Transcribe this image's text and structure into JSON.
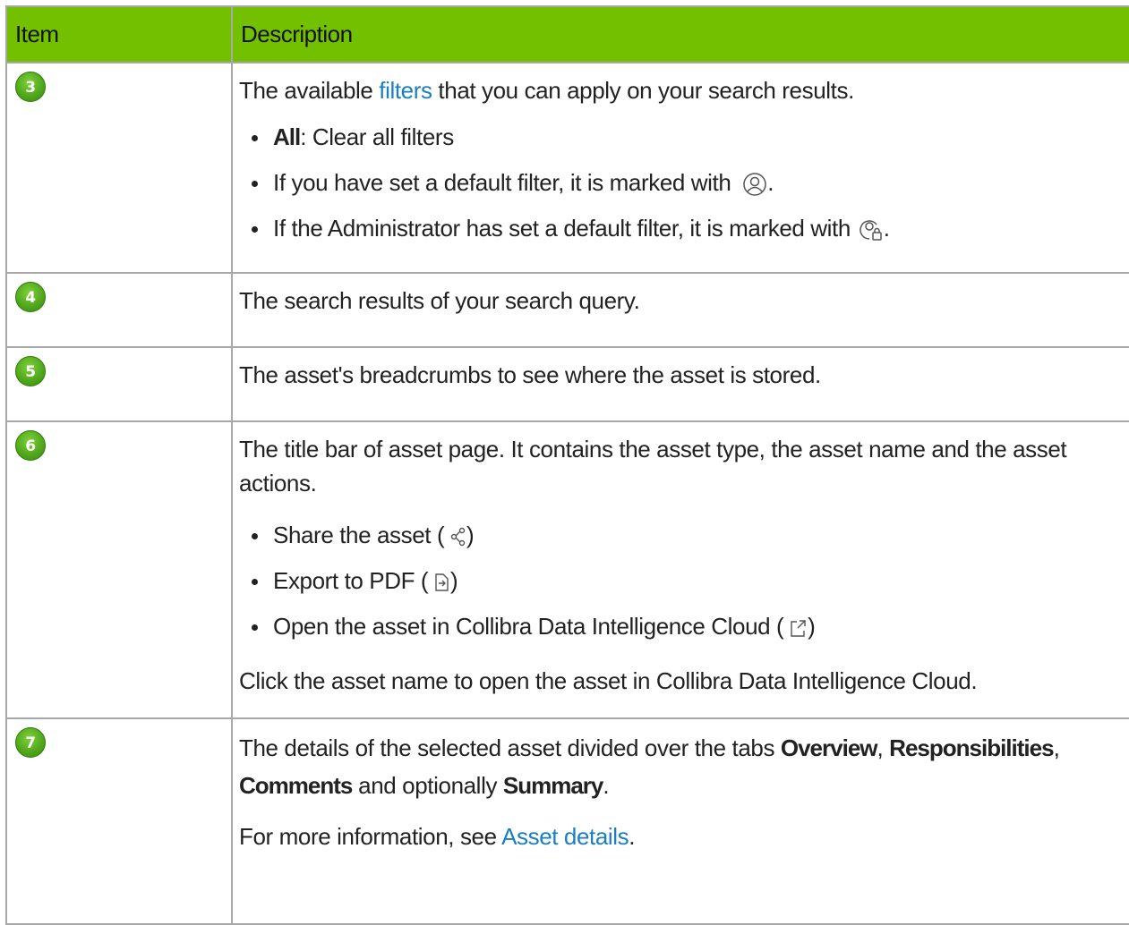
{
  "header": {
    "col_item": "Item",
    "col_description": "Description"
  },
  "rows": [
    {
      "badge": "3",
      "intro_before": "The available ",
      "intro_link": "filters",
      "intro_after": " that you can apply on your search results.",
      "bullets": {
        "b1_bold": "All",
        "b1_text": ": Clear all filters",
        "b2_text": "If you have set a default filter, it is marked with",
        "b2_icon": "user-circle-icon",
        "b2_end": ".",
        "b3_text": "If the Administrator has set a default filter, it is marked with",
        "b3_icon": "user-lock-icon",
        "b3_end": "."
      }
    },
    {
      "badge": "4",
      "text": "The search results of your search query."
    },
    {
      "badge": "5",
      "text": "The asset's breadcrumbs to see where the asset is stored."
    },
    {
      "badge": "6",
      "intro": "The title bar of asset page. It contains the asset type, the asset name and the asset actions.",
      "bullets": {
        "b1_text": "Share the asset (",
        "b1_icon": "share-icon",
        "b1_end": ")",
        "b2_text": "Export to PDF (",
        "b2_icon": "export-pdf-icon",
        "b2_end": ")",
        "b3_text": "Open the asset in Collibra Data Intelligence Cloud (",
        "b3_icon": "external-link-icon",
        "b3_end": ")"
      },
      "outro": "Click the asset name to open the asset in Collibra Data Intelligence Cloud."
    },
    {
      "badge": "7",
      "p1_a": "The details of the selected asset divided over the tabs ",
      "p1_b1": "Overview",
      "p1_c": ", ",
      "p1_b2": "Responsibilities",
      "p1_d": ", ",
      "p1_b3": "Comments",
      "p1_e": " and optionally ",
      "p1_b4": "Summary",
      "p1_f": ".",
      "p2_a": "For more information, see ",
      "p2_link": "Asset details",
      "p2_b": "."
    }
  ],
  "colors": {
    "header_bg": "#73c000",
    "link": "#1a7fc1",
    "border": "#a8a8a8",
    "badge": "#4ea51a"
  }
}
